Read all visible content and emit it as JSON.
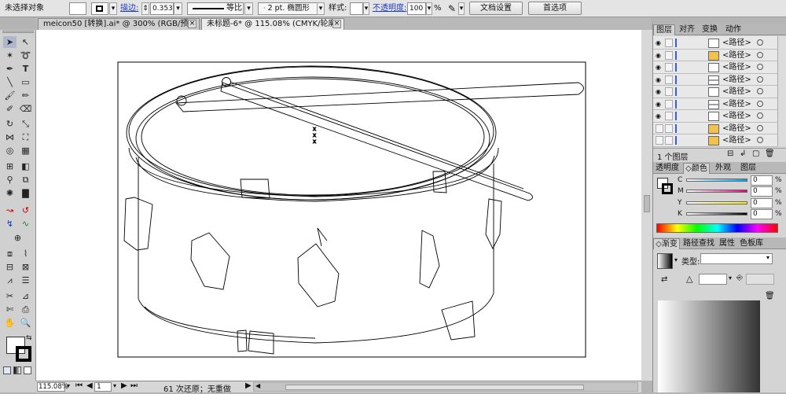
{
  "control_bar": {
    "selection_label": "未选择对象",
    "stroke_label": "描边:",
    "stroke_value": "0.353",
    "stroke_profile": "等比",
    "brush_value": "2 pt. 椭圆形",
    "style_label": "样式:",
    "opacity_label": "不透明度:",
    "opacity_value": "100",
    "opacity_unit": "%",
    "doc_setup_button": "文档设置",
    "prefs_button": "首选项"
  },
  "tabs": [
    {
      "label": "meicon50 [转换].ai* @ 300% (RGB/预览)",
      "active": false
    },
    {
      "label": "未标题-6* @ 115.08% (CMYK/轮廓)",
      "active": true
    }
  ],
  "layers_panel": {
    "tabs": [
      "图层",
      "对齐",
      "变换",
      "动作"
    ],
    "rows": [
      {
        "label": "<路径>",
        "eye": true,
        "thumb": "white"
      },
      {
        "label": "<路径>",
        "eye": true,
        "thumb": "yellow"
      },
      {
        "label": "<路径>",
        "eye": true,
        "thumb": "white"
      },
      {
        "label": "<路径>",
        "eye": true,
        "thumb": "line"
      },
      {
        "label": "<路径>",
        "eye": true,
        "thumb": "white"
      },
      {
        "label": "<路径>",
        "eye": true,
        "thumb": "line"
      },
      {
        "label": "<路径>",
        "eye": true,
        "thumb": "white"
      },
      {
        "label": "<路径>",
        "eye": false,
        "thumb": "yellow"
      },
      {
        "label": "<路径>",
        "eye": false,
        "thumb": "yellow"
      }
    ],
    "footer": "1 个图层"
  },
  "color_panel": {
    "tabs": [
      "透明度",
      "颜色",
      "外观",
      "图层"
    ],
    "channels": [
      {
        "name": "C",
        "value": "0",
        "gradient": "linear-gradient(90deg,#fff,#00a0e9)"
      },
      {
        "name": "M",
        "value": "0",
        "gradient": "linear-gradient(90deg,#fff,#e4007f)"
      },
      {
        "name": "Y",
        "value": "0",
        "gradient": "linear-gradient(90deg,#fff,#fff100)"
      },
      {
        "name": "K",
        "value": "0",
        "gradient": "linear-gradient(90deg,#fff,#000)"
      }
    ],
    "unit": "%"
  },
  "gradient_panel": {
    "tabs": [
      "渐变",
      "路径查找",
      "属性",
      "色板库"
    ],
    "type_label": "类型:"
  },
  "status_bar": {
    "zoom": "115.08%",
    "page": "1",
    "undo_text": "61 次还原；无重做"
  },
  "colors": {
    "accent_blue": "#3c5ce0",
    "link_blue": "#1f3cc8",
    "layer_yellow": "#f2c14e"
  }
}
